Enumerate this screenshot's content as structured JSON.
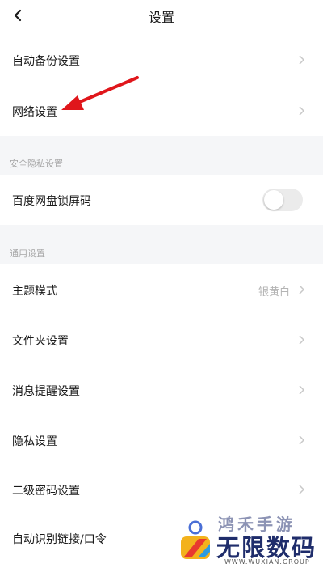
{
  "header": {
    "title": "设置"
  },
  "rows": {
    "backup": {
      "label": "自动备份设置"
    },
    "network": {
      "label": "网络设置"
    },
    "lock": {
      "label": "百度网盘锁屏码",
      "enabled": false
    },
    "theme": {
      "label": "主题模式",
      "value": "银黄白"
    },
    "folder": {
      "label": "文件夹设置"
    },
    "notify": {
      "label": "消息提醒设置"
    },
    "privacy": {
      "label": "隐私设置"
    },
    "password2": {
      "label": "二级密码设置"
    },
    "autolink": {
      "label": "自动识别链接/口令"
    }
  },
  "sections": {
    "security": "安全隐私设置",
    "general": "通用设置"
  },
  "watermark": {
    "top": "鸿禾手游",
    "main": "无限数码",
    "sub": "WWW.WUXIAN.GROUP"
  },
  "colors": {
    "annotation_arrow": "#e0161b",
    "section_bg": "#f5f6f8",
    "brand_navy": "#1f2d6b"
  }
}
